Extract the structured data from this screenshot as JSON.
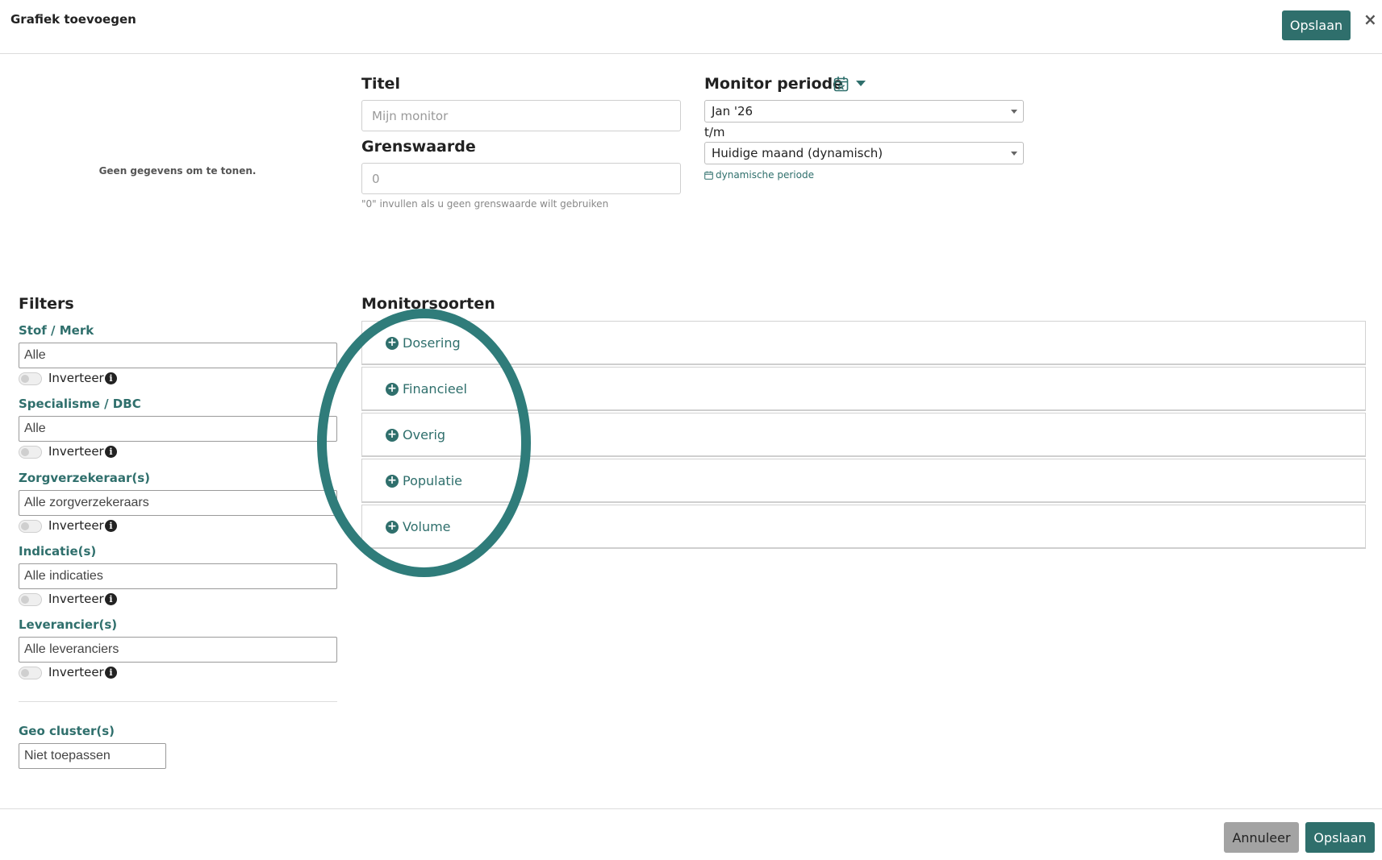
{
  "header": {
    "title": "Grafiek toevoegen",
    "save_label": "Opslaan",
    "close_label": "×"
  },
  "preview": {
    "empty_text": "Geen gegevens om te tonen."
  },
  "form": {
    "title_label": "Titel",
    "title_placeholder": "Mijn monitor",
    "threshold_label": "Grenswaarde",
    "threshold_placeholder": "0",
    "threshold_hint": "\"0\" invullen als u geen grenswaarde wilt gebruiken"
  },
  "period": {
    "label": "Monitor periode",
    "from_value": "Jan '26",
    "until_label": "t/m",
    "to_value": "Huidige maand (dynamisch)",
    "dynamic_link": "dynamische periode"
  },
  "filters": {
    "heading": "Filters",
    "items": [
      {
        "label": "Stof / Merk",
        "value": "Alle",
        "toggle_label": "Inverteer"
      },
      {
        "label": "Specialisme / DBC",
        "value": "Alle",
        "toggle_label": "Inverteer"
      },
      {
        "label": "Zorgverzekeraar(s)",
        "value": "Alle zorgverzekeraars",
        "toggle_label": "Inverteer"
      },
      {
        "label": "Indicatie(s)",
        "value": "Alle indicaties",
        "toggle_label": "Inverteer"
      },
      {
        "label": "Leverancier(s)",
        "value": "Alle leveranciers",
        "toggle_label": "Inverteer"
      }
    ],
    "geo_label": "Geo cluster(s)",
    "geo_value": "Niet toepassen"
  },
  "monitor_types": {
    "heading": "Monitorsoorten",
    "items": [
      "Dosering",
      "Financieel",
      "Overig",
      "Populatie",
      "Volume"
    ]
  },
  "footer": {
    "cancel_label": "Annuleer",
    "save_label": "Opslaan"
  },
  "colors": {
    "accent": "#2f6f6c",
    "highlight": "#2f7c7a",
    "cancel": "#a3a3a3"
  }
}
